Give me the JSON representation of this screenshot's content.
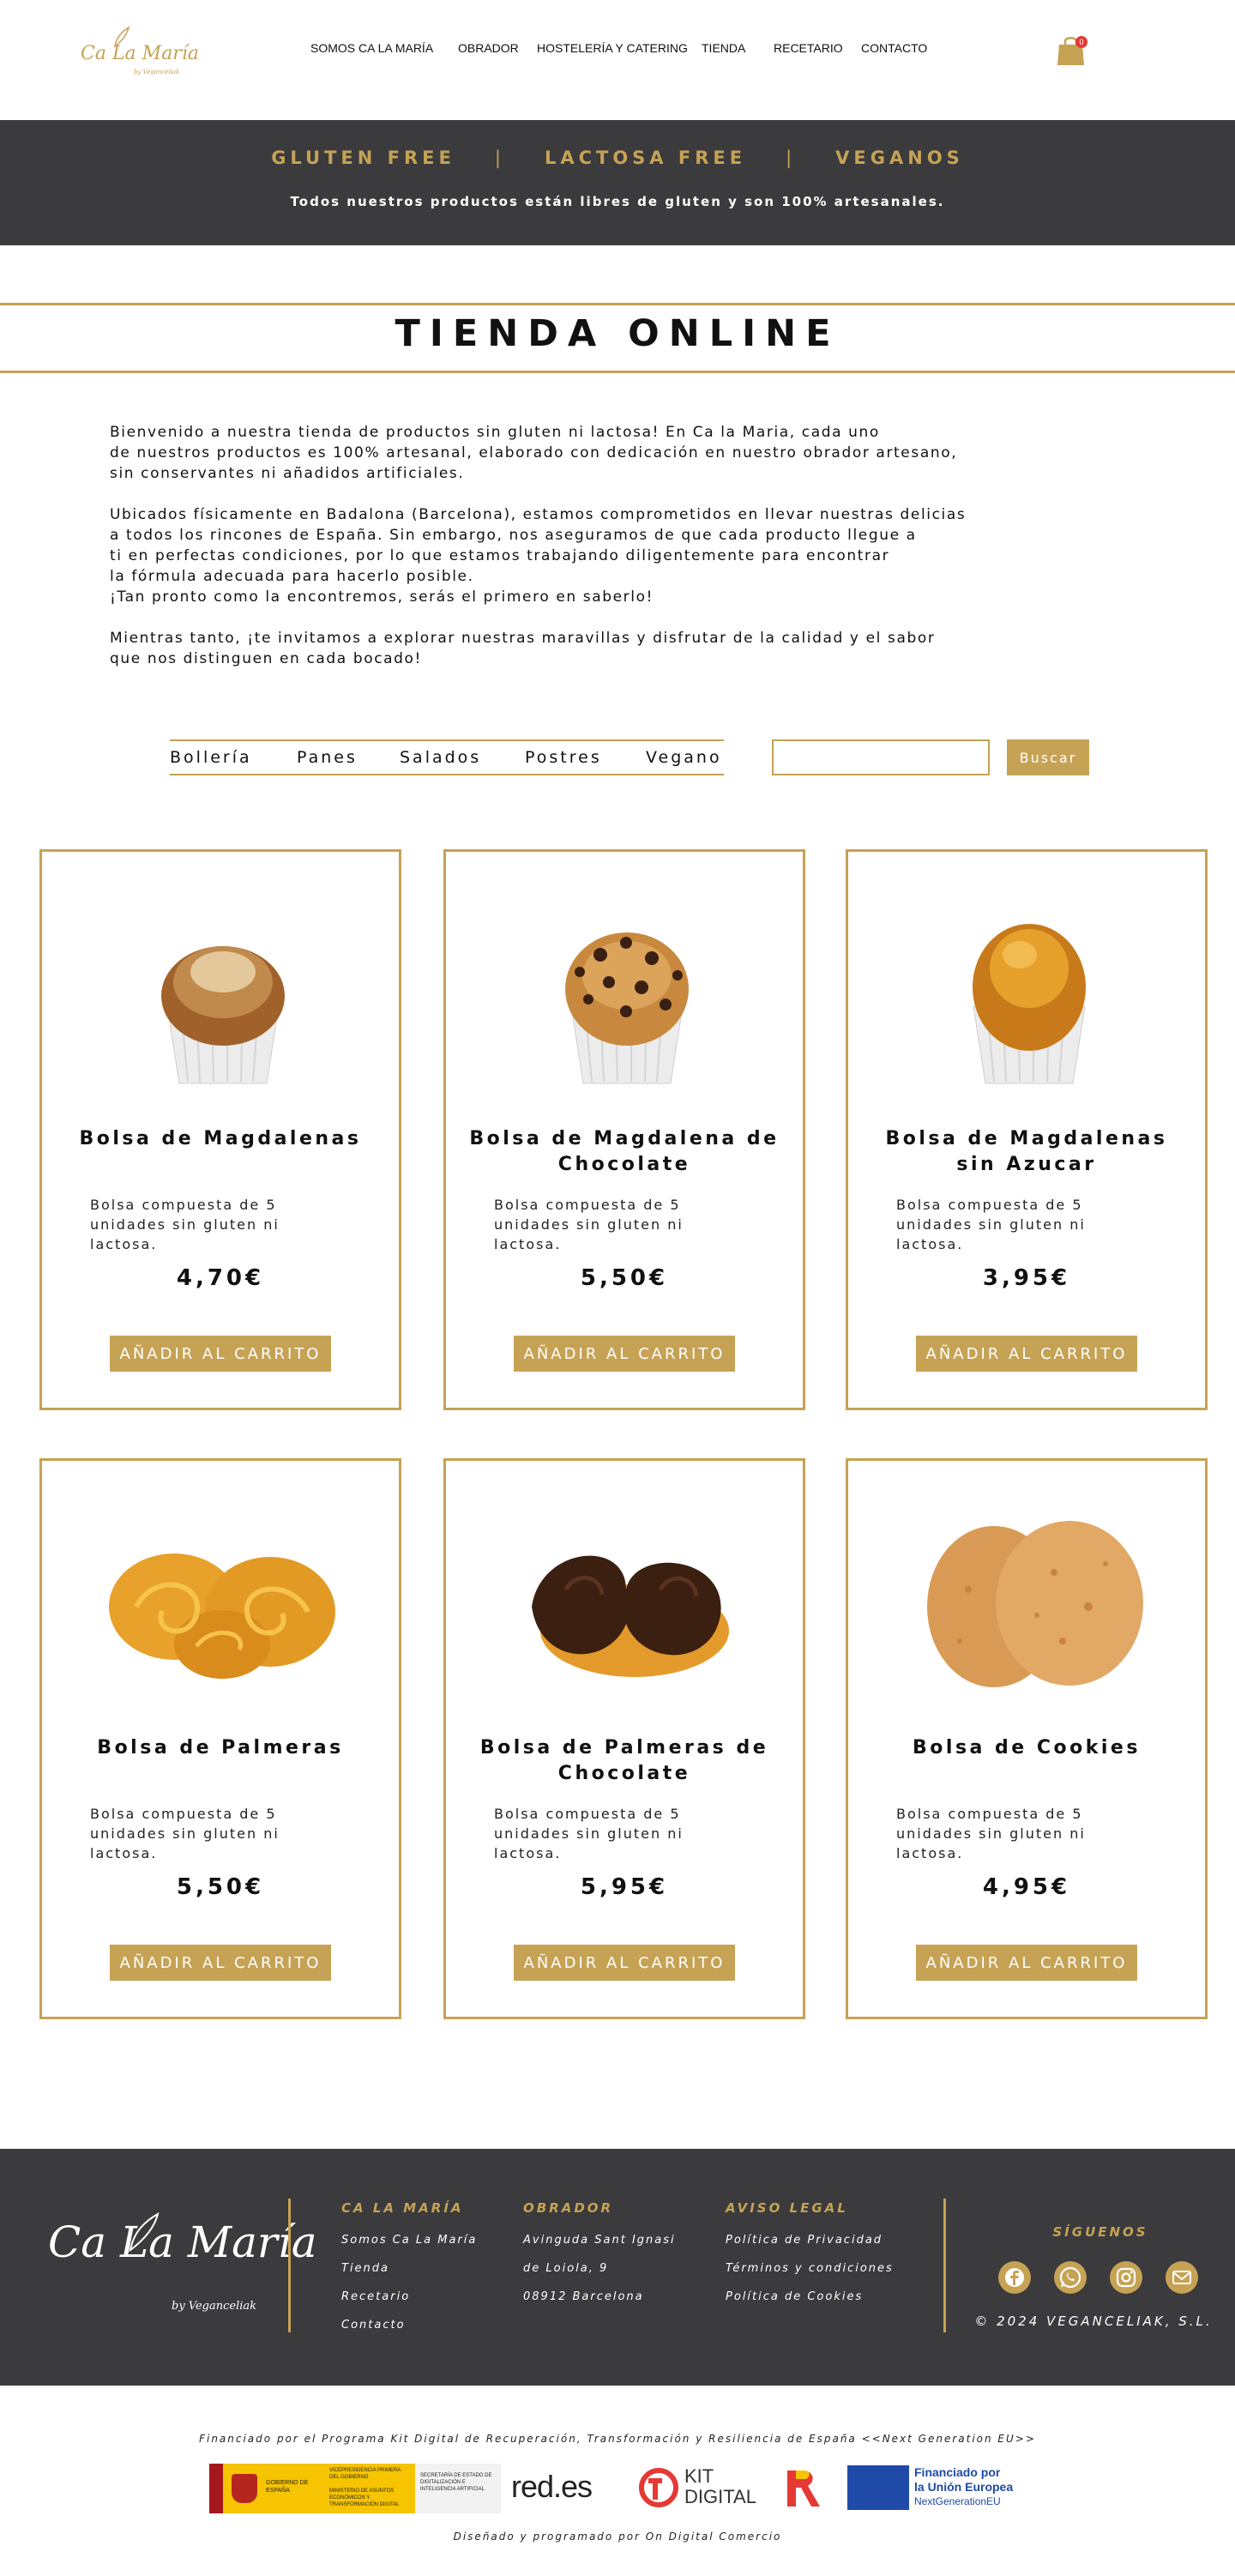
{
  "brand": {
    "logo_text": "Ca La María",
    "logo_sub": "by Veganceliak",
    "accent_color": "#c6a254",
    "dark_color": "#3b3b3d"
  },
  "nav": {
    "items": [
      "SOMOS CA LA MARÍA",
      "OBRADOR",
      "HOSTELERÍA Y CATERING",
      "TIENDA",
      "RECETARIO",
      "CONTACTO"
    ],
    "cart_count": "0",
    "cart_icon": "shopping-bag-icon"
  },
  "banner": {
    "tag1": "GLUTEN FREE",
    "tag2": "LACTOSA FREE",
    "tag3": "VEGANOS",
    "separator": "|",
    "subtitle": "Todos nuestros productos están libres de gluten y son 100% artesanales."
  },
  "page_title": "TIENDA ONLINE",
  "intro": {
    "p1": "Bienvenido a nuestra tienda de productos sin gluten ni lactosa! En Ca la Maria, cada uno\nde nuestros productos es 100% artesanal, elaborado con dedicación en nuestro obrador artesano,\nsin conservantes ni añadidos artificiales.",
    "p2": "Ubicados físicamente en Badalona (Barcelona), estamos comprometidos en llevar nuestras delicias\na todos los rincones de España. Sin embargo, nos aseguramos de que cada producto llegue a\nti en perfectas condiciones, por lo que estamos trabajando diligentemente para encontrar\nla fórmula adecuada para hacerlo posible.\n¡Tan pronto como la encontremos, serás el primero en saberlo!",
    "p3": "Mientras tanto, ¡te invitamos a explorar nuestras maravillas y disfrutar de la calidad y el sabor\nque nos distinguen en cada bocado!"
  },
  "filters": {
    "categories": [
      "Bollería",
      "Panes",
      "Salados",
      "Postres",
      "Vegano"
    ],
    "search_value": "",
    "search_button": "Buscar"
  },
  "products": [
    {
      "name": "Bolsa de Magdalenas",
      "desc": "Bolsa compuesta de 5 unidades sin gluten ni lactosa.",
      "price": "4,70€",
      "button": "AÑADIR AL CARRITO",
      "image": "magdalena"
    },
    {
      "name": "Bolsa de Magdalena de Chocolate",
      "desc": "Bolsa compuesta de 5 unidades sin gluten ni lactosa.",
      "price": "5,50€",
      "button": "AÑADIR AL CARRITO",
      "image": "magdalena-chocolate"
    },
    {
      "name": "Bolsa de Magdalenas sin Azucar",
      "desc": "Bolsa compuesta de 5 unidades sin gluten ni lactosa.",
      "price": "3,95€",
      "button": "AÑADIR AL CARRITO",
      "image": "magdalena-sin-azucar"
    },
    {
      "name": "Bolsa de Palmeras",
      "desc": "Bolsa compuesta de 5 unidades sin gluten ni lactosa.",
      "price": "5,50€",
      "button": "AÑADIR AL CARRITO",
      "image": "palmera"
    },
    {
      "name": "Bolsa de Palmeras de Chocolate",
      "desc": "Bolsa compuesta de 5 unidades sin gluten ni lactosa.",
      "price": "5,95€",
      "button": "AÑADIR AL CARRITO",
      "image": "palmera-chocolate"
    },
    {
      "name": "Bolsa de Cookies",
      "desc": "Bolsa compuesta de 5 unidades sin gluten ni lactosa.",
      "price": "4,95€",
      "button": "AÑADIR AL CARRITO",
      "image": "cookies"
    }
  ],
  "footer": {
    "logo_text": "Ca La María",
    "logo_sub": "by Veganceliak",
    "col1": {
      "title": "CA LA MARÍA",
      "links": [
        "Somos Ca La María",
        "Tienda",
        "Recetario",
        "Contacto"
      ]
    },
    "col2": {
      "title": "OBRADOR",
      "lines": [
        "Avinguda Sant Ignasi",
        "de Loiola, 9",
        "08912 Barcelona"
      ]
    },
    "col3": {
      "title": "AVISO LEGAL",
      "links": [
        "Política de Privacidad",
        "Términos y condiciones",
        "Política de Cookies"
      ]
    },
    "follow_title": "SÍGUENOS",
    "socials": [
      "facebook-icon",
      "whatsapp-icon",
      "instagram-icon",
      "mail-icon"
    ],
    "copyright": "© 2024 VEGANCELIAK, S.L."
  },
  "funding": {
    "text": "Financiado por el Programa Kit Digital de Recuperación, Transformación y Resiliencia de España <<Next Generation EU>>",
    "gobierno_lines": [
      "GOBIERNO DE ESPAÑA",
      "VICEPRESIDENCIA PRIMERA DEL GOBIERNO",
      "MINISTERIO DE ASUNTOS ECONÓMICOS Y TRANSFORMACIÓN DIGITAL"
    ],
    "secretaria": "SECRETARÍA DE ESTADO DE DIGITALIZACIÓN E INTELIGENCIA ARTIFICIAL",
    "redes": "red.es",
    "kit": "KIT",
    "digital": "DIGITAL",
    "eu_line1": "Financiado por",
    "eu_line2": "la Unión Europea",
    "eu_line3": "NextGenerationEU",
    "designer": "Diseñado y programado por On Digital Comercio"
  }
}
